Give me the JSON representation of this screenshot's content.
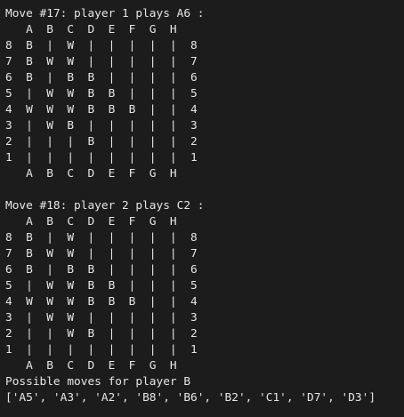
{
  "terminal": {
    "lines": [
      "Move #17: player 1 plays A6 :",
      "   A  B  C  D  E  F  G  H",
      "8  B  |  W  |  |  |  |  |  8",
      "7  B  W  W  |  |  |  |  |  7",
      "6  B  |  B  B  |  |  |  |  6",
      "5  |  W  W  B  B  |  |  |  5",
      "4  W  W  W  B  B  B  |  |  4",
      "3  |  W  B  |  |  |  |  |  3",
      "2  |  |  |  B  |  |  |  |  2",
      "1  |  |  |  |  |  |  |  |  1",
      "   A  B  C  D  E  F  G  H",
      "",
      "Move #18: player 2 plays C2 :",
      "   A  B  C  D  E  F  G  H",
      "8  B  |  W  |  |  |  |  |  8",
      "7  B  W  W  |  |  |  |  |  7",
      "6  B  |  B  B  |  |  |  |  6",
      "5  |  W  W  B  B  |  |  |  5",
      "4  W  W  W  B  B  B  |  |  4",
      "3  |  W  W  |  |  |  |  |  3",
      "2  |  |  W  B  |  |  |  |  2",
      "1  |  |  |  |  |  |  |  |  1",
      "   A  B  C  D  E  F  G  H",
      "Possible moves for player B",
      "['A5', 'A3', 'A2', 'B8', 'B6', 'B2', 'C1', 'D7', 'D3']"
    ]
  }
}
